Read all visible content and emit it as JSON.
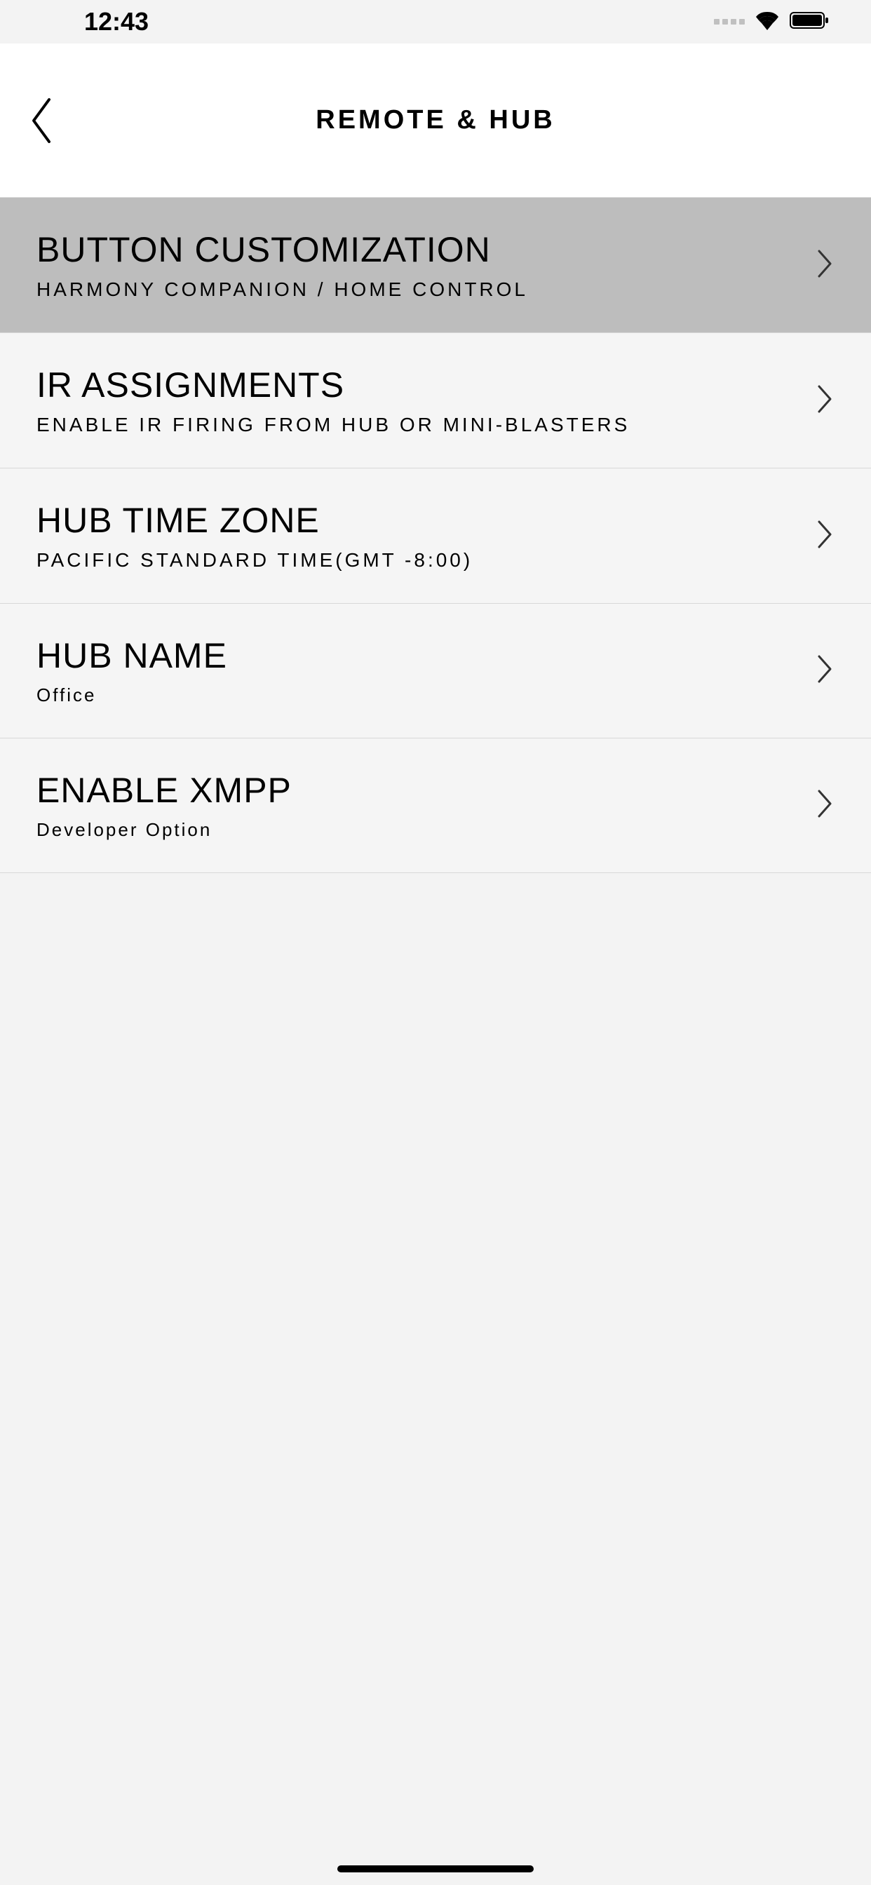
{
  "statusBar": {
    "time": "12:43"
  },
  "header": {
    "title": "REMOTE & HUB"
  },
  "items": [
    {
      "title": "BUTTON CUSTOMIZATION",
      "subtitle": "HARMONY COMPANION / HOME CONTROL",
      "highlighted": true
    },
    {
      "title": "IR ASSIGNMENTS",
      "subtitle": "ENABLE IR FIRING FROM HUB OR MINI-BLASTERS",
      "highlighted": false
    },
    {
      "title": "HUB TIME ZONE",
      "subtitle": "PACIFIC STANDARD TIME(GMT -8:00)",
      "highlighted": false
    },
    {
      "title": "HUB NAME",
      "subtitle": "Office",
      "highlighted": false,
      "subtitleSmall": true
    },
    {
      "title": "ENABLE XMPP",
      "subtitle": "Developer Option",
      "highlighted": false,
      "subtitleSmall": true
    }
  ]
}
